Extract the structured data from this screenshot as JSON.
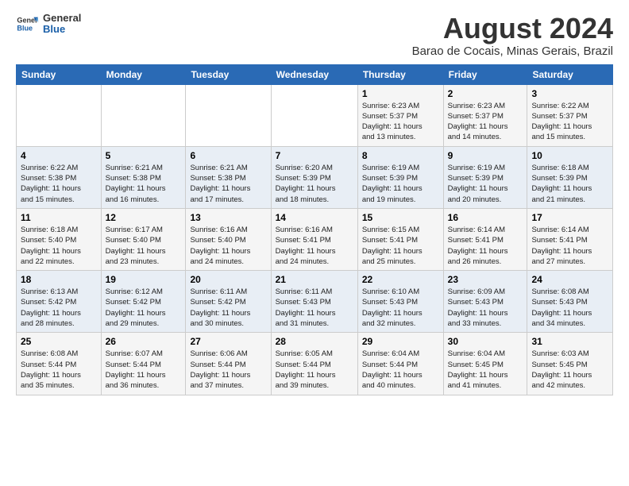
{
  "header": {
    "logo_line1": "General",
    "logo_line2": "Blue",
    "main_title": "August 2024",
    "subtitle": "Barao de Cocais, Minas Gerais, Brazil"
  },
  "calendar": {
    "days_of_week": [
      "Sunday",
      "Monday",
      "Tuesday",
      "Wednesday",
      "Thursday",
      "Friday",
      "Saturday"
    ],
    "weeks": [
      [
        {
          "day": "",
          "info": ""
        },
        {
          "day": "",
          "info": ""
        },
        {
          "day": "",
          "info": ""
        },
        {
          "day": "",
          "info": ""
        },
        {
          "day": "1",
          "info": "Sunrise: 6:23 AM\nSunset: 5:37 PM\nDaylight: 11 hours\nand 13 minutes."
        },
        {
          "day": "2",
          "info": "Sunrise: 6:23 AM\nSunset: 5:37 PM\nDaylight: 11 hours\nand 14 minutes."
        },
        {
          "day": "3",
          "info": "Sunrise: 6:22 AM\nSunset: 5:37 PM\nDaylight: 11 hours\nand 15 minutes."
        }
      ],
      [
        {
          "day": "4",
          "info": "Sunrise: 6:22 AM\nSunset: 5:38 PM\nDaylight: 11 hours\nand 15 minutes."
        },
        {
          "day": "5",
          "info": "Sunrise: 6:21 AM\nSunset: 5:38 PM\nDaylight: 11 hours\nand 16 minutes."
        },
        {
          "day": "6",
          "info": "Sunrise: 6:21 AM\nSunset: 5:38 PM\nDaylight: 11 hours\nand 17 minutes."
        },
        {
          "day": "7",
          "info": "Sunrise: 6:20 AM\nSunset: 5:39 PM\nDaylight: 11 hours\nand 18 minutes."
        },
        {
          "day": "8",
          "info": "Sunrise: 6:19 AM\nSunset: 5:39 PM\nDaylight: 11 hours\nand 19 minutes."
        },
        {
          "day": "9",
          "info": "Sunrise: 6:19 AM\nSunset: 5:39 PM\nDaylight: 11 hours\nand 20 minutes."
        },
        {
          "day": "10",
          "info": "Sunrise: 6:18 AM\nSunset: 5:39 PM\nDaylight: 11 hours\nand 21 minutes."
        }
      ],
      [
        {
          "day": "11",
          "info": "Sunrise: 6:18 AM\nSunset: 5:40 PM\nDaylight: 11 hours\nand 22 minutes."
        },
        {
          "day": "12",
          "info": "Sunrise: 6:17 AM\nSunset: 5:40 PM\nDaylight: 11 hours\nand 23 minutes."
        },
        {
          "day": "13",
          "info": "Sunrise: 6:16 AM\nSunset: 5:40 PM\nDaylight: 11 hours\nand 24 minutes."
        },
        {
          "day": "14",
          "info": "Sunrise: 6:16 AM\nSunset: 5:41 PM\nDaylight: 11 hours\nand 24 minutes."
        },
        {
          "day": "15",
          "info": "Sunrise: 6:15 AM\nSunset: 5:41 PM\nDaylight: 11 hours\nand 25 minutes."
        },
        {
          "day": "16",
          "info": "Sunrise: 6:14 AM\nSunset: 5:41 PM\nDaylight: 11 hours\nand 26 minutes."
        },
        {
          "day": "17",
          "info": "Sunrise: 6:14 AM\nSunset: 5:41 PM\nDaylight: 11 hours\nand 27 minutes."
        }
      ],
      [
        {
          "day": "18",
          "info": "Sunrise: 6:13 AM\nSunset: 5:42 PM\nDaylight: 11 hours\nand 28 minutes."
        },
        {
          "day": "19",
          "info": "Sunrise: 6:12 AM\nSunset: 5:42 PM\nDaylight: 11 hours\nand 29 minutes."
        },
        {
          "day": "20",
          "info": "Sunrise: 6:11 AM\nSunset: 5:42 PM\nDaylight: 11 hours\nand 30 minutes."
        },
        {
          "day": "21",
          "info": "Sunrise: 6:11 AM\nSunset: 5:43 PM\nDaylight: 11 hours\nand 31 minutes."
        },
        {
          "day": "22",
          "info": "Sunrise: 6:10 AM\nSunset: 5:43 PM\nDaylight: 11 hours\nand 32 minutes."
        },
        {
          "day": "23",
          "info": "Sunrise: 6:09 AM\nSunset: 5:43 PM\nDaylight: 11 hours\nand 33 minutes."
        },
        {
          "day": "24",
          "info": "Sunrise: 6:08 AM\nSunset: 5:43 PM\nDaylight: 11 hours\nand 34 minutes."
        }
      ],
      [
        {
          "day": "25",
          "info": "Sunrise: 6:08 AM\nSunset: 5:44 PM\nDaylight: 11 hours\nand 35 minutes."
        },
        {
          "day": "26",
          "info": "Sunrise: 6:07 AM\nSunset: 5:44 PM\nDaylight: 11 hours\nand 36 minutes."
        },
        {
          "day": "27",
          "info": "Sunrise: 6:06 AM\nSunset: 5:44 PM\nDaylight: 11 hours\nand 37 minutes."
        },
        {
          "day": "28",
          "info": "Sunrise: 6:05 AM\nSunset: 5:44 PM\nDaylight: 11 hours\nand 39 minutes."
        },
        {
          "day": "29",
          "info": "Sunrise: 6:04 AM\nSunset: 5:44 PM\nDaylight: 11 hours\nand 40 minutes."
        },
        {
          "day": "30",
          "info": "Sunrise: 6:04 AM\nSunset: 5:45 PM\nDaylight: 11 hours\nand 41 minutes."
        },
        {
          "day": "31",
          "info": "Sunrise: 6:03 AM\nSunset: 5:45 PM\nDaylight: 11 hours\nand 42 minutes."
        }
      ]
    ]
  }
}
